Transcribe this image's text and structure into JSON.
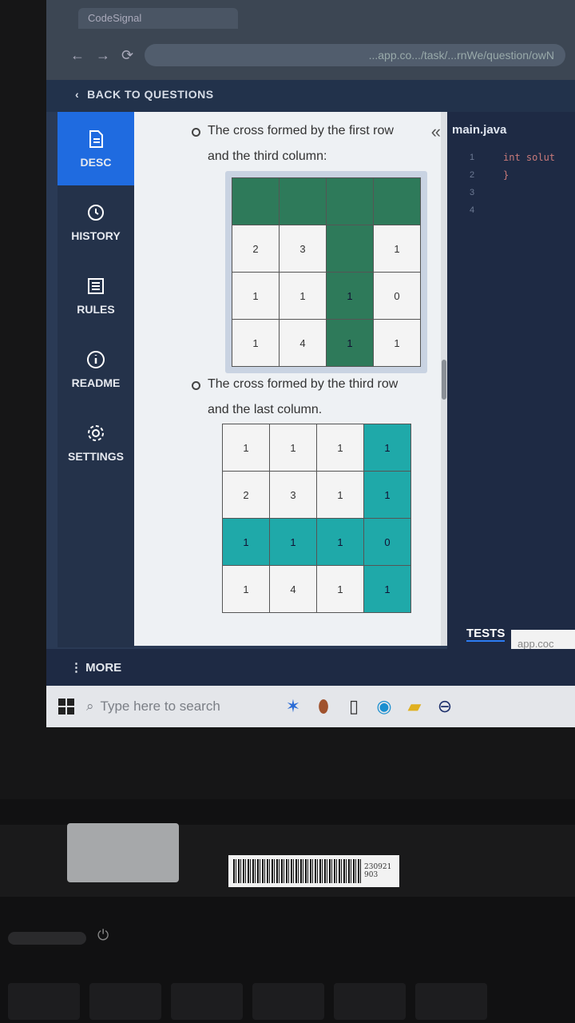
{
  "browser": {
    "tab_title": "CodeSignal",
    "url": "...app.co.../task/...rnWe/question/owN"
  },
  "header": {
    "back_label": "BACK TO QUESTIONS"
  },
  "sidebar": {
    "items": [
      {
        "label": "DESC"
      },
      {
        "label": "HISTORY"
      },
      {
        "label": "RULES"
      },
      {
        "label": "README"
      },
      {
        "label": "SETTINGS"
      }
    ]
  },
  "description": {
    "bullet1": "The cross formed by the first row and the third column:",
    "grid1": [
      [
        "",
        "",
        "",
        ""
      ],
      [
        "2",
        "3",
        "",
        "1"
      ],
      [
        "1",
        "1",
        "1",
        "0"
      ],
      [
        "1",
        "4",
        "1",
        "1"
      ]
    ],
    "bullet2": "The cross formed by the third row and the last column.",
    "grid2": [
      [
        "1",
        "1",
        "1",
        "1"
      ],
      [
        "2",
        "3",
        "1",
        "1"
      ],
      [
        "1",
        "1",
        "1",
        "0"
      ],
      [
        "1",
        "4",
        "1",
        "1"
      ]
    ]
  },
  "editor": {
    "file_tab": "main.java",
    "line_numbers": [
      "1",
      "2",
      "3",
      "4"
    ],
    "code_lines": [
      "int solut",
      "",
      "}",
      ""
    ]
  },
  "tests": {
    "tab_label": "TESTS"
  },
  "tooltip": {
    "text": "app.coc"
  },
  "more": {
    "label": "MORE"
  },
  "taskbar": {
    "search_placeholder": "Type here to search"
  },
  "barcode": {
    "line1": "230921",
    "line2": "903"
  },
  "colors": {
    "accent": "#1f6be0",
    "highlight_green": "#2e7a5a",
    "highlight_teal": "#1fa9a9"
  }
}
